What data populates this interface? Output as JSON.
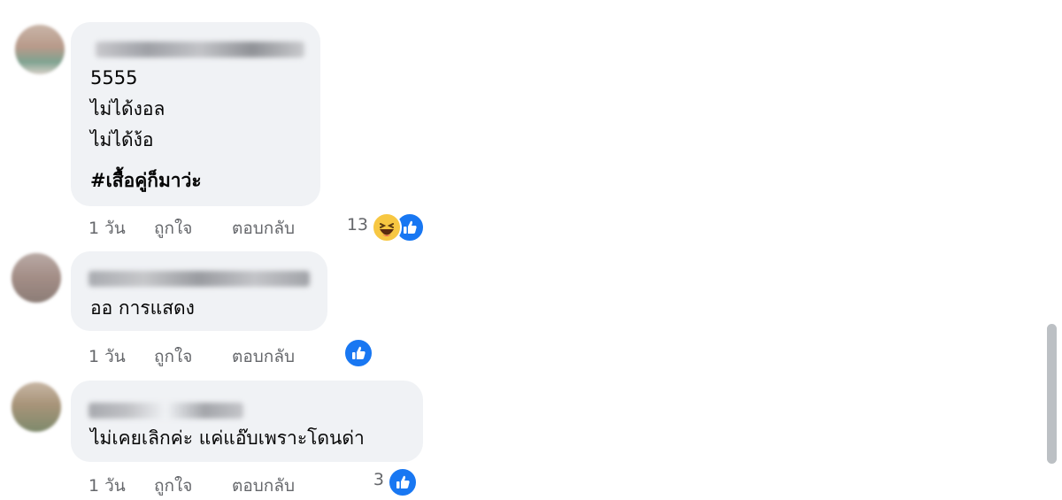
{
  "comments": [
    {
      "lines": [
        "5555",
        "ไม่ได้งอล",
        "ไม่ได้ง้อ"
      ],
      "hashtag": "#เสื้อคู่ก็มาว่ะ",
      "time": "1 วัน",
      "like": "ถูกใจ",
      "reply": "ตอบกลับ",
      "reaction_count": "13",
      "reaction_icons": [
        "haha-icon",
        "like-icon"
      ]
    },
    {
      "lines": [
        "ออ การแสดง"
      ],
      "time": "1 วัน",
      "like": "ถูกใจ",
      "reply": "ตอบกลับ",
      "reaction_count": "",
      "reaction_icons": [
        "like-icon"
      ]
    },
    {
      "lines": [
        "ไม่เคยเลิกค่ะ แค่แอ๊บเพราะโดนด่า"
      ],
      "time": "1 วัน",
      "like": "ถูกใจ",
      "reply": "ตอบกลับ",
      "reaction_count": "3",
      "reaction_icons": [
        "like-icon"
      ]
    }
  ],
  "colors": {
    "bubble": "#f0f2f5",
    "meta_text": "#65676b",
    "like_blue": "#1877f2",
    "haha_yellow": "#f7c742"
  }
}
